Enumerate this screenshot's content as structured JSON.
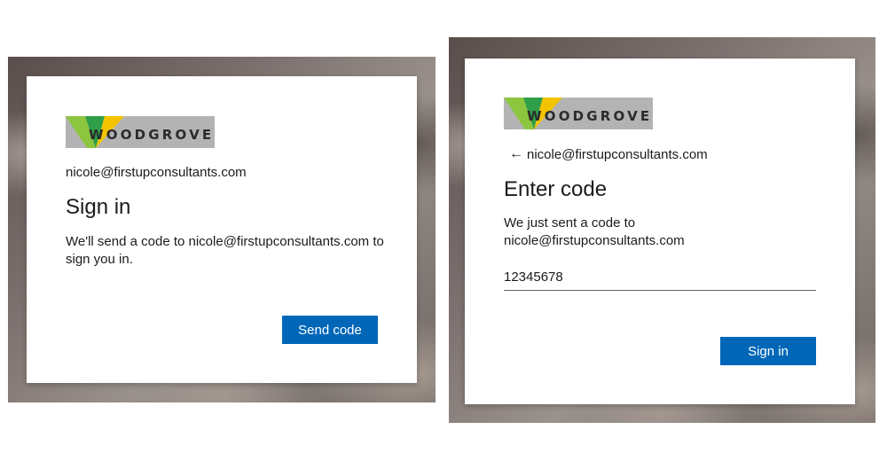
{
  "brand": {
    "logo_text": "WOODGROVE",
    "logo_colors": {
      "green": "#8cc63f",
      "dark_green": "#2e9e48",
      "yellow": "#f4c300",
      "bar": "#b3b3b3"
    }
  },
  "left_screen": {
    "email": "nicole@firstupconsultants.com",
    "title": "Sign in",
    "description": "We'll send a code to nicole@firstupconsultants.com to sign you in.",
    "send_button": "Send code"
  },
  "right_screen": {
    "back_icon": "←",
    "email": "nicole@firstupconsultants.com",
    "title": "Enter code",
    "description": "We just sent a code to nicole@firstupconsultants.com",
    "code_value": "12345678",
    "signin_button": "Sign in"
  },
  "colors": {
    "primary": "#0067b8",
    "card": "#ffffff"
  }
}
